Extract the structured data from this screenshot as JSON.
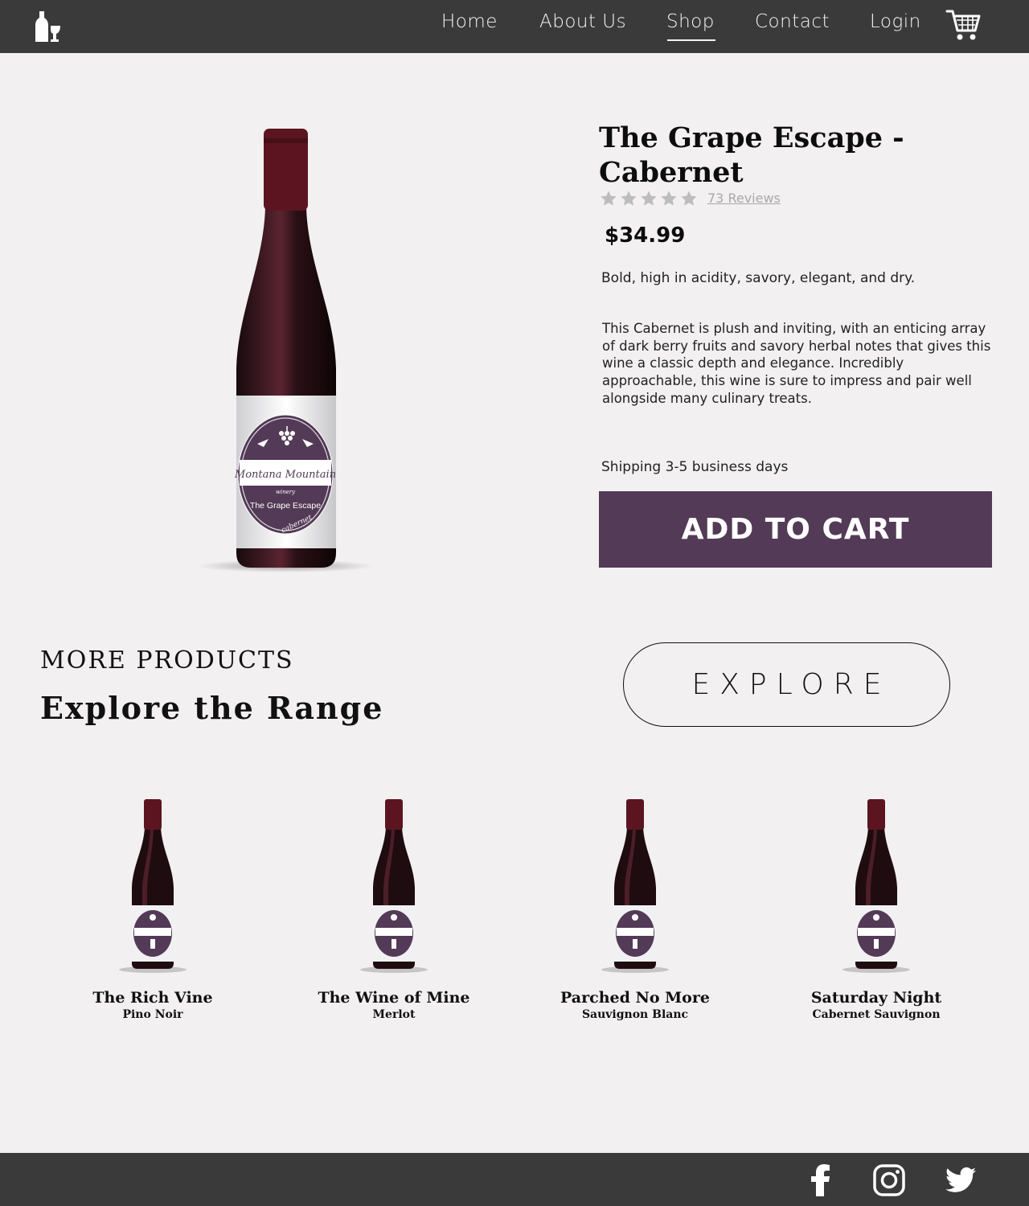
{
  "nav": {
    "items": [
      "Home",
      "About Us",
      "Shop",
      "Contact",
      "Login"
    ],
    "active": "Shop"
  },
  "product": {
    "title": "The Grape Escape - Cabernet",
    "rating": 5,
    "reviews": "73 Reviews",
    "price": "$34.99",
    "tagline": "Bold, high in acidity, savory, elegant, and dry.",
    "description": "This Cabernet is plush and inviting, with an enticing array of dark berry fruits and savory herbal notes that gives this wine a classic depth and elegance. Incredibly approachable, this wine is sure to impress and pair well alongside many culinary treats.",
    "shipping": "Shipping 3-5 business days",
    "add_to_cart": "ADD TO CART",
    "label": {
      "brand_line": "Montana Mountain",
      "sub_line": "winery",
      "wine_name": "The Grape Escape",
      "variety": "cabernet"
    }
  },
  "more": {
    "label": "MORE PRODUCTS",
    "title": "Explore the Range",
    "explore": "EXPLORE"
  },
  "related": [
    {
      "name": "The Rich Vine",
      "variety": "Pino Noir"
    },
    {
      "name": "The Wine of Mine",
      "variety": "Merlot"
    },
    {
      "name": "Parched No More",
      "variety": "Sauvignon Blanc"
    },
    {
      "name": "Saturday Night",
      "variety": "Cabernet Sauvignon"
    }
  ],
  "colors": {
    "nav_bg": "#3a3a3a",
    "page_bg": "#f2f0f1",
    "accent": "#533a56",
    "star": "#bdbdbd"
  },
  "icons": [
    "wine-bottle-logo-icon",
    "shopping-cart-icon",
    "star-icon",
    "facebook-icon",
    "instagram-icon",
    "twitter-icon"
  ]
}
